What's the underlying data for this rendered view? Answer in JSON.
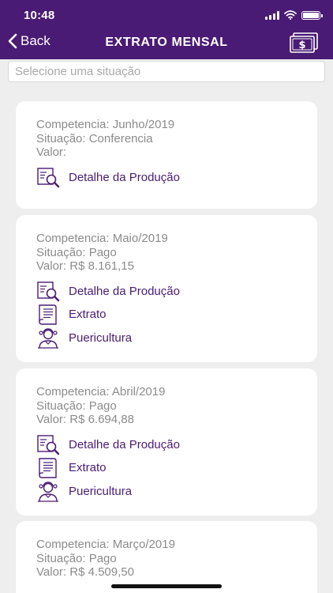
{
  "status_bar": {
    "time": "10:48"
  },
  "header": {
    "back_label": "Back",
    "title": "EXTRATO MENSAL",
    "right_icon": "money-bill-icon"
  },
  "search": {
    "placeholder": "Selecione uma situação",
    "value": ""
  },
  "cards": [
    {
      "competencia": "Competencia: Junho/2019",
      "situacao": "Situação: Conferencia",
      "valor": "Valor:",
      "actions": [
        {
          "label": "Detalhe da Produção",
          "icon": "production-detail-icon"
        }
      ]
    },
    {
      "competencia": "Competencia: Maio/2019",
      "situacao": "Situação: Pago",
      "valor": "Valor: R$ 8.161,15",
      "actions": [
        {
          "label": "Detalhe da Produção",
          "icon": "production-detail-icon"
        },
        {
          "label": "Extrato",
          "icon": "statement-document-icon"
        },
        {
          "label": "Puericultura",
          "icon": "child-care-icon"
        }
      ]
    },
    {
      "competencia": "Competencia: Abril/2019",
      "situacao": "Situação: Pago",
      "valor": "Valor: R$ 6.694,88",
      "actions": [
        {
          "label": "Detalhe da Produção",
          "icon": "production-detail-icon"
        },
        {
          "label": "Extrato",
          "icon": "statement-document-icon"
        },
        {
          "label": "Puericultura",
          "icon": "child-care-icon"
        }
      ]
    },
    {
      "competencia": "Competencia: Março/2019",
      "situacao": "Situação: Pago",
      "valor": "Valor: R$ 4.509,50",
      "actions": []
    }
  ],
  "colors": {
    "primary": "#4a1b74",
    "background": "#eeeeee",
    "card": "#ffffff",
    "muted_text": "#8b8b8b"
  }
}
